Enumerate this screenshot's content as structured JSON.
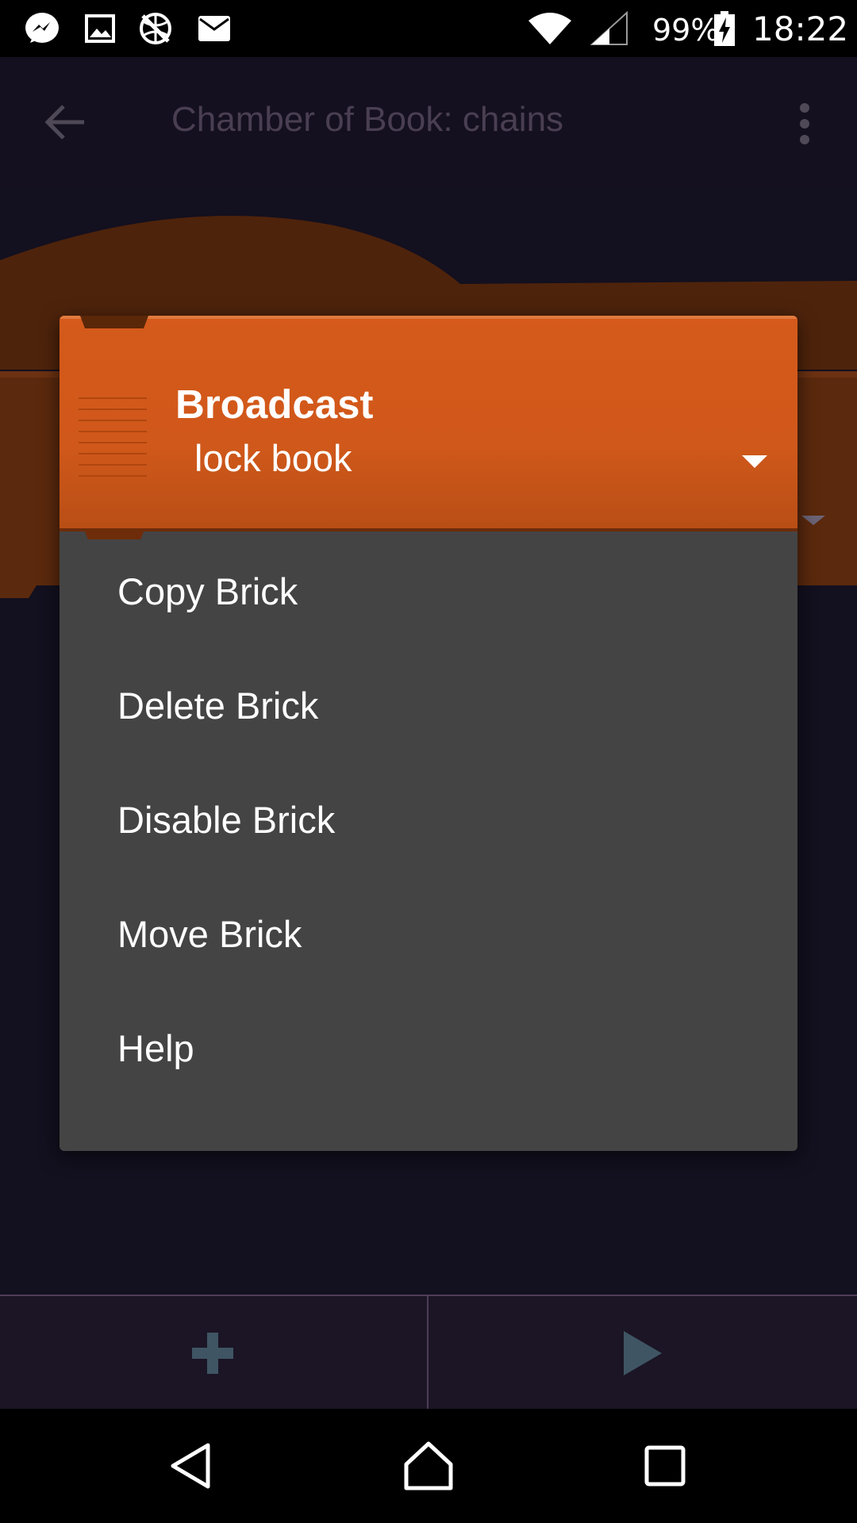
{
  "status_bar": {
    "icons": [
      "messenger-icon",
      "image-icon",
      "no-network-icon",
      "mail-icon",
      "wifi-icon",
      "signal-icon",
      "battery-charging-icon"
    ],
    "battery": "99%",
    "time": "18:22"
  },
  "toolbar": {
    "back_icon": "arrow-left-icon",
    "title": "Chamber of Book: chains",
    "overflow_icon": "more-vert-icon"
  },
  "context_menu": {
    "brick": {
      "title": "Broadcast",
      "value": "lock book",
      "dropdown_icon": "triangle-down-icon",
      "color": "#d55a1b"
    },
    "items": [
      {
        "label": "Copy Brick"
      },
      {
        "label": "Delete Brick"
      },
      {
        "label": "Disable Brick"
      },
      {
        "label": "Move Brick"
      },
      {
        "label": "Help"
      }
    ]
  },
  "bottom_bar": {
    "add_icon": "plus-icon",
    "play_icon": "play-icon",
    "icon_color": "#3f5563"
  },
  "nav_bar": {
    "back_icon": "nav-back-icon",
    "home_icon": "nav-home-icon",
    "recents_icon": "nav-recents-icon"
  }
}
